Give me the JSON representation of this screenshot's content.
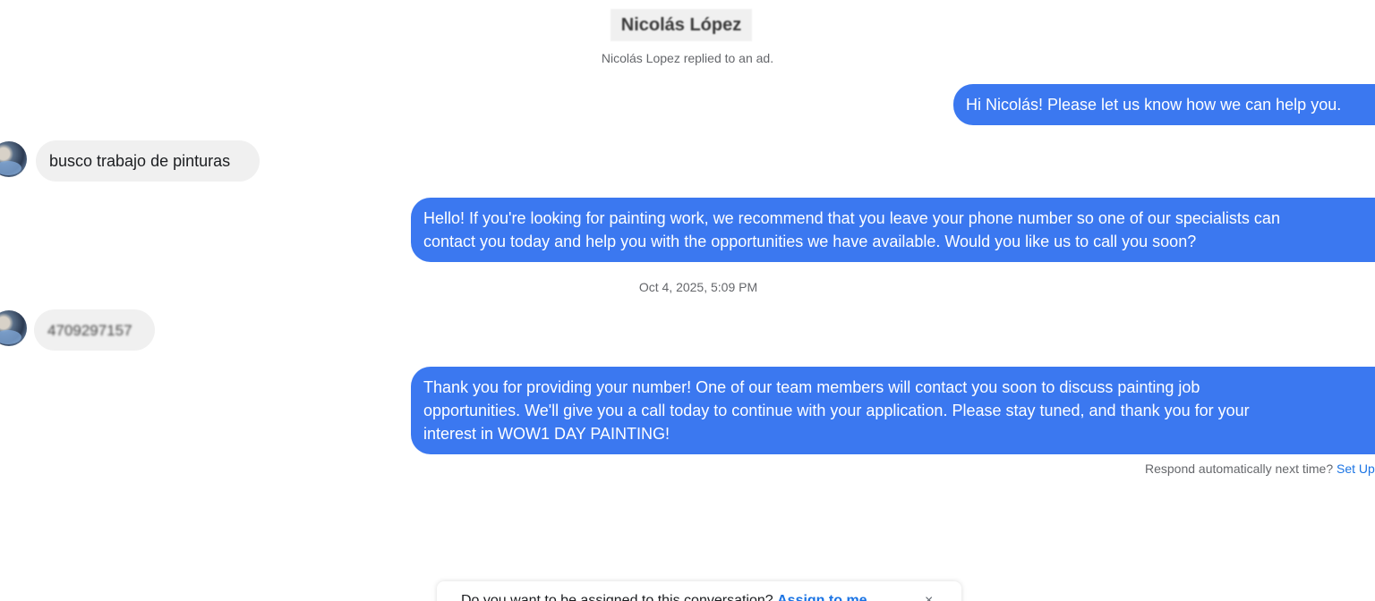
{
  "header": {
    "contact_name": "Nicolás López",
    "system_note": "Nicolás Lopez replied to an ad."
  },
  "messages": [
    {
      "direction": "outgoing",
      "text": "Hi Nicolás! Please let us know how we can help you."
    },
    {
      "direction": "incoming",
      "text": "busco trabajo de pinturas"
    },
    {
      "direction": "outgoing",
      "lines": [
        "Hello! If you're looking for painting work, we recommend that you leave your phone number so one of our specialists can",
        "contact you today and help you with the opportunities we have available. Would you like us to call you soon?"
      ]
    },
    {
      "direction": "incoming",
      "text": "4709297157"
    },
    {
      "direction": "outgoing",
      "lines": [
        "Thank you for providing your number! One of our team members will contact you soon to discuss painting job",
        "opportunities. We'll give you a call today to continue with your application. Please stay tuned, and thank you for your",
        "interest in WOW1 DAY PAINTING!"
      ]
    }
  ],
  "timestamp": "Oct 4, 2025, 5:09 PM",
  "auto_reply": {
    "prompt": "Respond automatically next time?",
    "link_label": "Set Up"
  },
  "bottom_banner": {
    "text": "Do you want to be assigned to this conversation?",
    "action_label": "Assign to me",
    "close_label": "×"
  },
  "colors": {
    "outgoing_bubble": "#3b78f0",
    "incoming_bubble": "#f0f0f0",
    "link": "#1b74e4"
  }
}
